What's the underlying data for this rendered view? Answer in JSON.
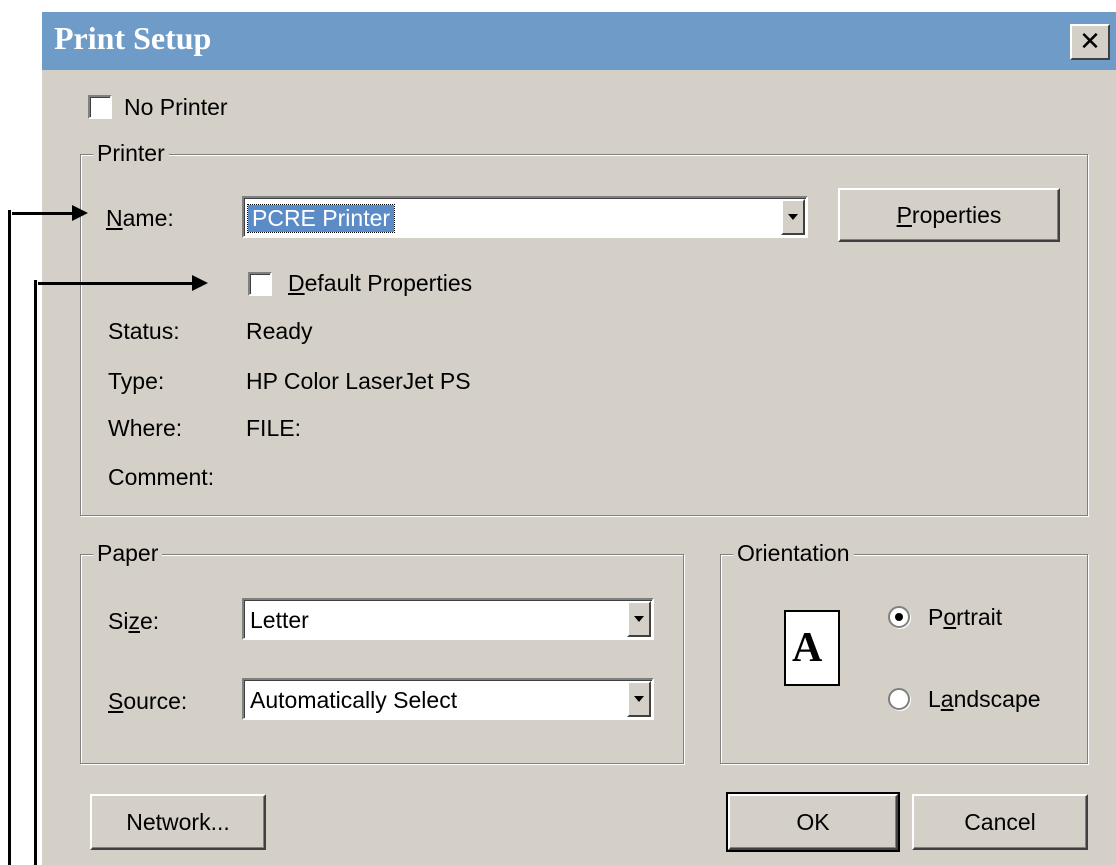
{
  "window": {
    "title": "Print Setup",
    "close_glyph": "✕"
  },
  "no_printer": {
    "label": "No Printer",
    "checked": false
  },
  "printer_group": {
    "legend": "Printer",
    "name_label": "Name:",
    "name_value": "PCRE Printer",
    "properties_button": "Properties",
    "default_properties_label": "Default Properties",
    "default_properties_checked": false,
    "status_label": "Status:",
    "status_value": "Ready",
    "type_label": "Type:",
    "type_value": "HP Color LaserJet PS",
    "where_label": "Where:",
    "where_value": "FILE:",
    "comment_label": "Comment:",
    "comment_value": ""
  },
  "paper_group": {
    "legend": "Paper",
    "size_label": "Size:",
    "size_value": "Letter",
    "source_label": "Source:",
    "source_value": "Automatically Select"
  },
  "orientation_group": {
    "legend": "Orientation",
    "page_glyph": "A",
    "portrait_label": "Portrait",
    "landscape_label": "Landscape",
    "selected": "Portrait"
  },
  "buttons": {
    "network": "Network...",
    "ok": "OK",
    "cancel": "Cancel"
  },
  "icons": [
    "close-icon",
    "page-orientation-icon",
    "dropdown-arrow-icon"
  ],
  "colors": {
    "titlebar": "#6f9bc9",
    "face": "#d4d0c8",
    "selection": "#5b8cc8"
  }
}
